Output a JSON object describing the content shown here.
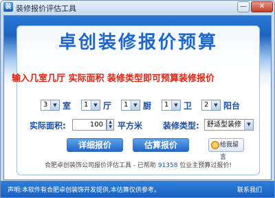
{
  "window": {
    "title": "装修报价评估工具",
    "app_icon_glyph": "装",
    "minimize_glyph": "—",
    "close_glyph": "✕"
  },
  "headline": "卓创装修报价预算",
  "subtitle": "输入几室几厅 实际面积 装修类型即可预算装修报价",
  "rooms": [
    {
      "value": "3",
      "unit": "室"
    },
    {
      "value": "1",
      "unit": "厅"
    },
    {
      "value": "1",
      "unit": "厨"
    },
    {
      "value": "1",
      "unit": "卫"
    },
    {
      "value": "2",
      "unit": "阳台"
    }
  ],
  "area": {
    "label": "实际面积:",
    "value": "100",
    "unit": "平方米"
  },
  "decor_type": {
    "label": "装修类型:",
    "value": "舒适型装修"
  },
  "buttons": {
    "detail": "详细报价",
    "estimate": "估算报价",
    "message": "给我留言"
  },
  "info": {
    "prefix": "合肥卓创装饰公司报价评估工具 - 已帮助",
    "count": "91358",
    "suffix": "位业主预算过报价!"
  },
  "status": {
    "disclaimer": "声明:本软件有合肥卓创装饰开发提供,本估算仅供参考。",
    "contact": "联系我们"
  },
  "colors": {
    "headline": "#1b67cf",
    "subtitle": "#e52212",
    "label": "#1b4fa6",
    "button": "#2466c6"
  }
}
